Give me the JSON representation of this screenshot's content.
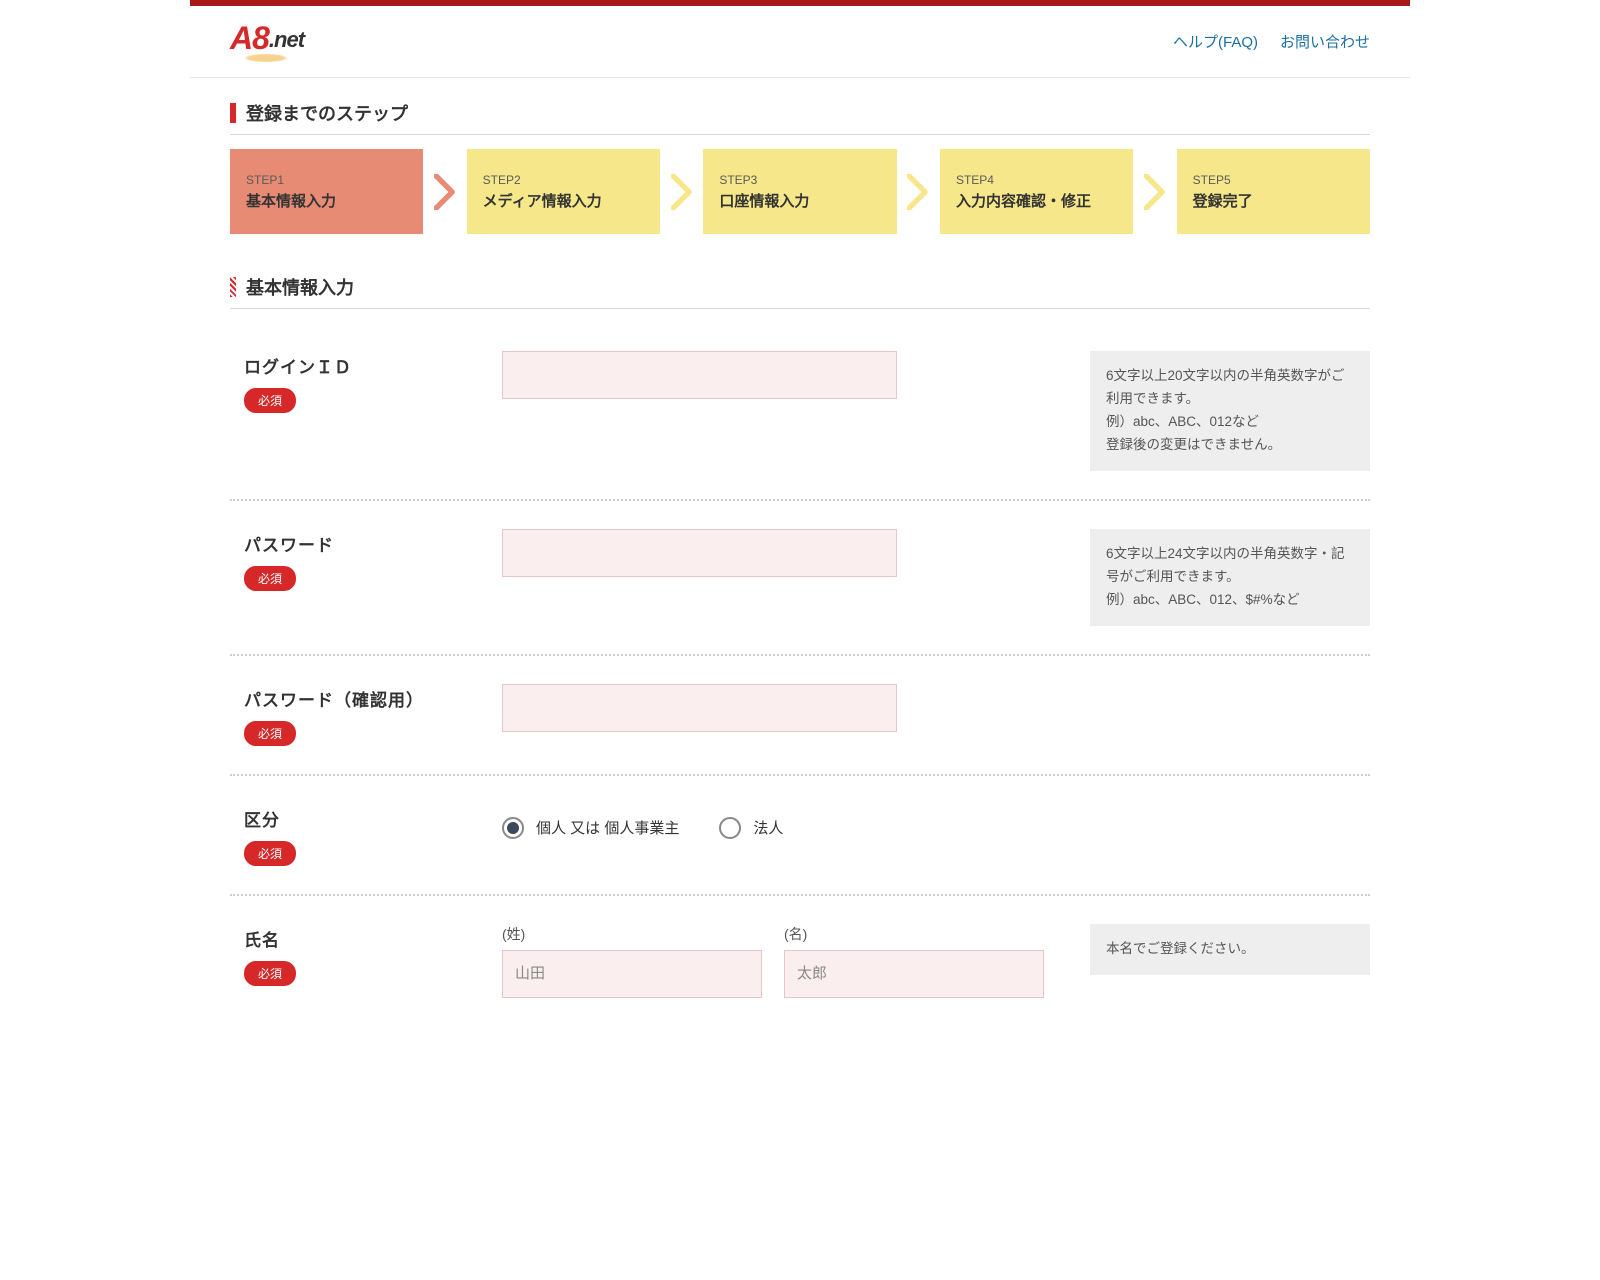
{
  "header": {
    "logo_main": "A8",
    "logo_sub": ".net",
    "nav": {
      "faq": "ヘルプ(FAQ)",
      "contact": "お問い合わせ"
    }
  },
  "sections": {
    "steps_title": "登録までのステップ",
    "form_title": "基本情報入力"
  },
  "steps": [
    {
      "num": "STEP1",
      "label": "基本情報入力",
      "active": true
    },
    {
      "num": "STEP2",
      "label": "メディア情報入力",
      "active": false
    },
    {
      "num": "STEP3",
      "label": "口座情報入力",
      "active": false
    },
    {
      "num": "STEP4",
      "label": "入力内容確認・修正",
      "active": false
    },
    {
      "num": "STEP5",
      "label": "登録完了",
      "active": false
    }
  ],
  "labels": {
    "required": "必須"
  },
  "form": {
    "login_id": {
      "label": "ログインＩＤ",
      "value": "",
      "help1": "6文字以上20文字以内の半角英数字がご利用できます。",
      "help2": "例）abc、ABC、012など",
      "help3": "登録後の変更はできません。"
    },
    "password": {
      "label": "パスワード",
      "value": "",
      "help1": "6文字以上24文字以内の半角英数字・記号がご利用できます。",
      "help2": "例）abc、ABC、012、$#%など"
    },
    "password_confirm": {
      "label": "パスワード（確認用）",
      "value": ""
    },
    "category": {
      "label": "区分",
      "option1": "個人  又は  個人事業主",
      "option2": "法人",
      "selected": "individual"
    },
    "name": {
      "label": "氏名",
      "last_sub": "(姓)",
      "first_sub": "(名)",
      "last_placeholder": "山田",
      "first_placeholder": "太郎",
      "help": "本名でご登録ください。"
    }
  }
}
